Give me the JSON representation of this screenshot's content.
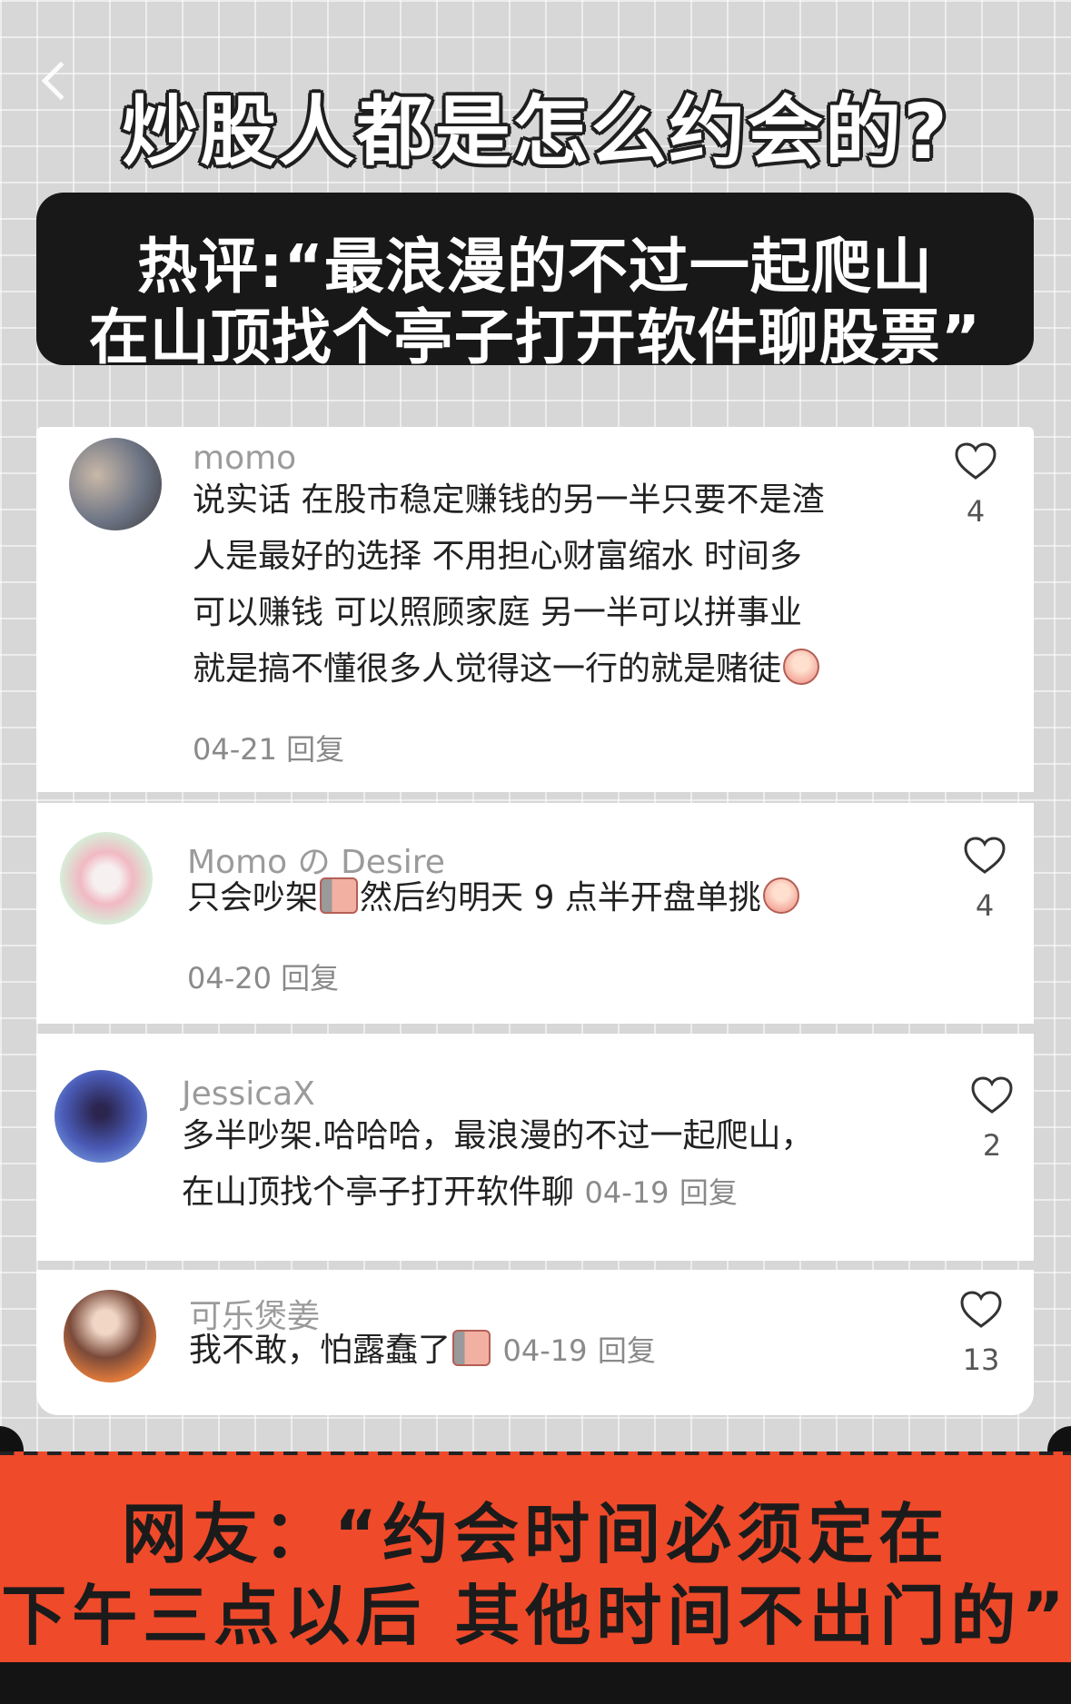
{
  "header": {
    "title": "炒股人都是怎么约会的?",
    "hot_comment_line1": "热评:“最浪漫的不过一起爬山",
    "hot_comment_line2": "在山顶找个亭子打开软件聊股票”"
  },
  "comments": [
    {
      "username": "momo",
      "lines": [
        "说实话 在股市稳定赚钱的另一半只要不是渣",
        "人是最好的选择 不用担心财富缩水 时间多",
        "可以赚钱 可以照顾家庭 另一半可以拼事业",
        "就是搞不懂很多人觉得这一行的就是赌徒"
      ],
      "date": "04-21",
      "reply": "回复",
      "likes": "4"
    },
    {
      "username": "Momo の Desire",
      "text_a": "只会吵架",
      "text_b": "然后约明天 9 点半开盘单挑",
      "date": "04-20",
      "reply": "回复",
      "likes": "4"
    },
    {
      "username": "JessicaX",
      "line1": "多半吵架.哈哈哈，最浪漫的不过一起爬山，",
      "line2": "在山顶找个亭子打开软件聊",
      "date": "04-19",
      "reply": "回复",
      "likes": "2"
    },
    {
      "username": "可乐煲姜",
      "text": "我不敢，怕露蠢了",
      "date": "04-19",
      "reply": "回复",
      "likes": "13"
    }
  ],
  "footer": {
    "line1": "网友：“约会时间必须定在",
    "line2": "下午三点以后 其他时间不出门的”"
  },
  "icons": {
    "back": "chevron-left-icon",
    "like": "heart-outline-icon",
    "emoji": "crying-laughing-emoji"
  },
  "colors": {
    "accent_orange": "#ef4a2a",
    "dark_box": "#181818"
  }
}
